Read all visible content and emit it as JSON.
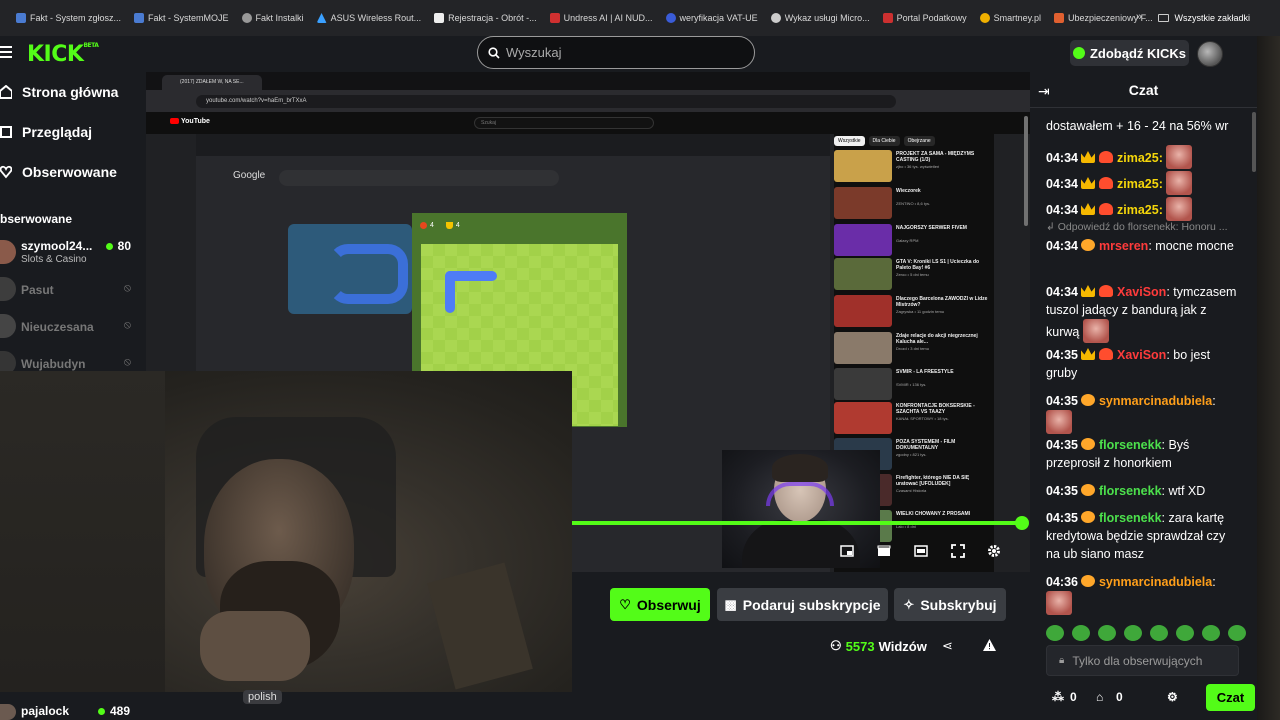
{
  "bookmarks": {
    "items": [
      {
        "label": "Fakt - System zgłosz...",
        "color": "#4a7bd1"
      },
      {
        "label": "Fakt - SystemMOJE",
        "color": "#4a7bd1"
      },
      {
        "label": "Fakt Instalki",
        "color": "#999999"
      },
      {
        "label": "ASUS Wireless Rout...",
        "color": "#3aa0ff"
      },
      {
        "label": "Rejestracja - Obrót -...",
        "color": "#ffffff"
      },
      {
        "label": "Undress AI | AI NUD...",
        "color": "#d03030"
      },
      {
        "label": "weryfikacja VAT-UE",
        "color": "#3a5cd8"
      },
      {
        "label": "Wykaz usługi Micro...",
        "color": "#cccccc"
      },
      {
        "label": "Portal Podatkowy",
        "color": "#cc3030"
      },
      {
        "label": "Smartney.pl",
        "color": "#f0b000"
      },
      {
        "label": "Ubezpieczeniowy F...",
        "color": "#e06030"
      }
    ],
    "more_label": "»",
    "all_label": "Wszystkie zakładki"
  },
  "header": {
    "logo": "KICK",
    "logo_beta": "BETA",
    "search_placeholder": "Wyszukaj",
    "kicks_button": "Zdobądź KICKs"
  },
  "sidebar": {
    "nav": [
      {
        "label": "Strona główna"
      },
      {
        "label": "Przeglądaj"
      },
      {
        "label": "Obserwowane"
      }
    ],
    "section_title": "bserwowane",
    "channels": [
      {
        "name": "szymool24...",
        "category": "Slots & Casino",
        "viewers": "80",
        "live": true,
        "avatar": "#8a5a4a"
      },
      {
        "name": "Pasut",
        "live": false,
        "avatar": "#7a7a7a"
      },
      {
        "name": "Nieuczesana",
        "live": false,
        "avatar": "#8a8a8a"
      },
      {
        "name": "Wujabudyn",
        "live": false,
        "avatar": "#6a6a6a"
      }
    ],
    "footer_channel": {
      "name": "pajalock",
      "viewers": "489"
    }
  },
  "stream": {
    "browser_tab": "(2017) ZDAŁEM W, NA SE...",
    "url": "youtube.com/watch?v=haEm_brTXxA",
    "yt_search": "Szukaj",
    "google_logo": "Google",
    "game_score": "4",
    "game_best": "4",
    "yt_chips": [
      "Wszystkie",
      "Dla Ciebie",
      "Obejrzane"
    ],
    "yt_videos": [
      {
        "title": "PROJEKT ZA SAMA - MIĘDZYMS CASTING (1/3)",
        "meta": "zjbo • 36 tys. wyświetleń",
        "color": "#c9a14a"
      },
      {
        "title": "Wieczorek",
        "meta": "ZENTINO • 8,6 tys.",
        "color": "#7b3a2a"
      },
      {
        "title": "NAJGORSZY SERWER FIVEM",
        "meta": "Galaxy RPM",
        "color": "#6a2da8"
      },
      {
        "title": "GTA V: Kroniki LS S1 | Ucieczka do Paleto Bay! #6",
        "meta": "Zeroo • 5 dni temu",
        "color": "#5a6a3a"
      },
      {
        "title": "Dlaczego Barcelona ZAWODZI w Lidze Mistrzów?",
        "meta": "Zagrywka • 11 godzin temu",
        "color": "#a0302a"
      },
      {
        "title": "Zdaje relacje do akcji niegrzecznej Kalucha ale...",
        "meta": "Drozd • 3 dni temu",
        "color": "#8a7a6a"
      },
      {
        "title": "SVMIR - LA FREESTYLE",
        "meta": "SVMIR • 136 tys.",
        "color": "#3a3a3a"
      },
      {
        "title": "KONFRONTACJE BOKSERSKIE - SZACHTA VS TAAZY",
        "meta": "KANAŁ SPORTOWY • 18 tys.",
        "color": "#b03a30"
      },
      {
        "title": "POZA SYSTEMEM - FILM DOKUMENTALNY",
        "meta": "zgodny • 821 tys.",
        "color": "#2a3a4a"
      },
      {
        "title": "Firefighter, którego NIE DA SIĘ uratować [UFOLUDEK]",
        "meta": "Czasami Historia",
        "color": "#4a2a2a"
      },
      {
        "title": "WIELKI CHOWANY Z PROSAMI",
        "meta": "Lalo • 8 dni",
        "color": "#5a7a4a"
      }
    ],
    "cam_tag": "polish"
  },
  "actions": {
    "follow": "Obserwuj",
    "gift": "Podaruj subskrypcje",
    "subscribe": "Subskrybuj",
    "viewers_count": "5573",
    "viewers_label": "Widzów"
  },
  "chat": {
    "title": "Czat",
    "reply_text": "Odpowiedź do florsenekk: Honoru ...",
    "messages": [
      {
        "time": "",
        "user": "",
        "text": "dostawałem + 16 - 24 na 56% wr",
        "color": "#ffffff"
      },
      {
        "time": "04:34",
        "user": "zima25",
        "text": "",
        "color": "#f5d60a"
      },
      {
        "time": "04:34",
        "user": "zima25",
        "text": "",
        "color": "#f5d60a"
      },
      {
        "time": "04:34",
        "user": "zima25",
        "text": "",
        "color": "#f5d60a"
      },
      {
        "time": "04:34",
        "user": "mrseren",
        "text": "mocne mocne",
        "color": "#ff3b3b"
      },
      {
        "time": "04:34",
        "user": "XaviSon",
        "text": "tymczasem tuszol jadący z bandurą jak z kurwą",
        "color": "#ff3b3b"
      },
      {
        "time": "04:35",
        "user": "XaviSon",
        "text": "bo jest gruby",
        "color": "#ff3b3b"
      },
      {
        "time": "04:35",
        "user": "synmarcinadubiela",
        "text": "",
        "color": "#ff9f1a"
      },
      {
        "time": "04:35",
        "user": "florsenekk",
        "text": "Byś przeprosił z honorkiem",
        "color": "#4ce04c"
      },
      {
        "time": "04:35",
        "user": "florsenekk",
        "text": "wtf XD",
        "color": "#4ce04c"
      },
      {
        "time": "04:35",
        "user": "florsenekk",
        "text": "zara kartę kredytowa będzie sprawdzał czy na ub siano masz",
        "color": "#4ce04c"
      },
      {
        "time": "04:36",
        "user": "synmarcinadubiela",
        "text": "",
        "color": "#ff9f1a"
      }
    ],
    "input_placeholder": "Tylko dla obserwujących",
    "footer_count_a": "0",
    "footer_count_b": "0",
    "send_label": "Czat"
  },
  "colors": {
    "accent": "#53fc18",
    "bg": "#191b1f",
    "button": "#3a3d42"
  }
}
